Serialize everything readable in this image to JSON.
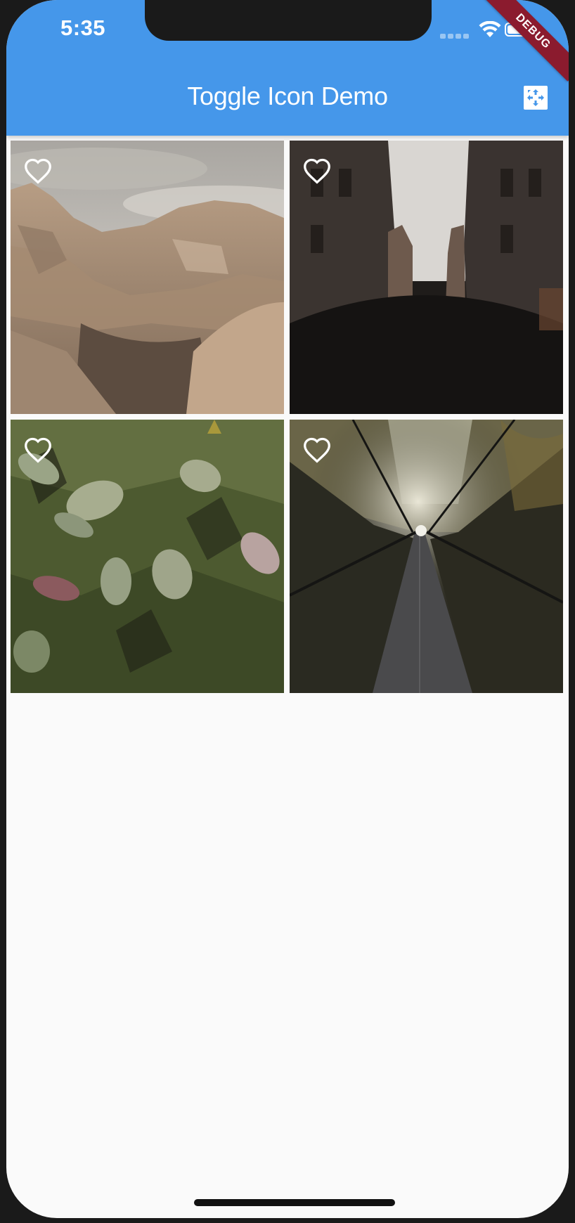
{
  "status_bar": {
    "time": "5:35",
    "icons": [
      "cellular-signal-icon",
      "wifi-icon",
      "battery-icon"
    ]
  },
  "debug_banner": "DEBUG",
  "app_bar": {
    "title": "Toggle Icon Demo",
    "action_icon": "fullscreen-icon",
    "background_color": "#4597ea"
  },
  "gallery": {
    "items": [
      {
        "photo": "desert-rock-formations",
        "favorite": false,
        "favorite_icon": "heart-outline-icon"
      },
      {
        "photo": "narrow-city-street-crowd",
        "favorite": false,
        "favorite_icon": "heart-outline-icon"
      },
      {
        "photo": "leaves-on-textured-wall",
        "favorite": false,
        "favorite_icon": "heart-outline-icon"
      },
      {
        "photo": "suspension-bridge-forest",
        "favorite": false,
        "favorite_icon": "heart-outline-icon"
      }
    ]
  }
}
